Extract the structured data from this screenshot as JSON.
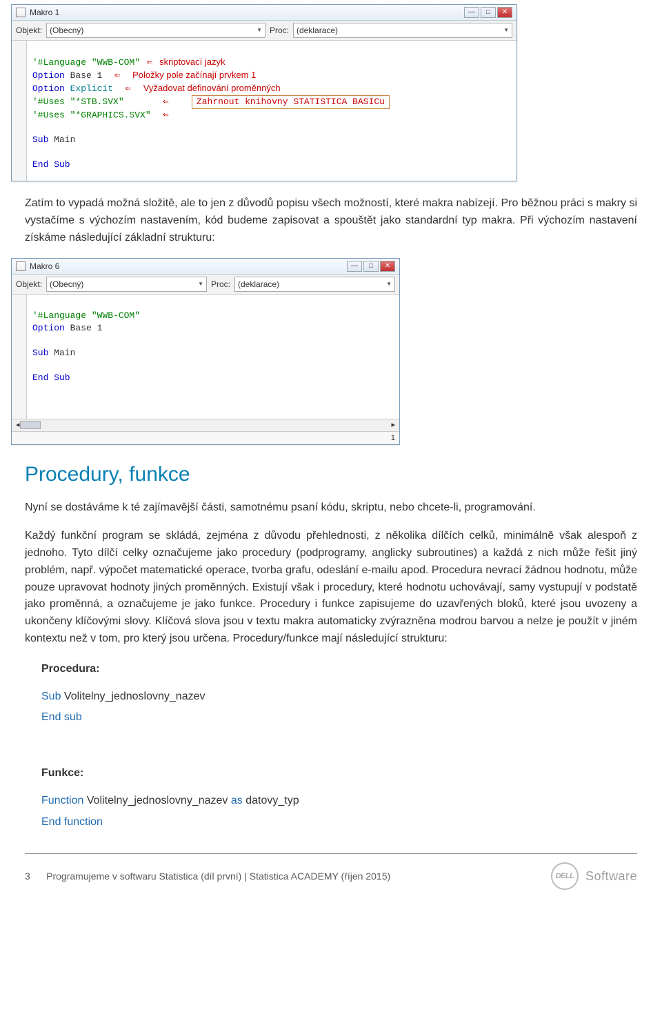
{
  "ide1": {
    "title": "Makro 1",
    "objektLabel": "Objekt:",
    "objektValue": "(Obecný)",
    "procLabel": "Proc:",
    "procValue": "(deklarace)",
    "code": {
      "l1a": "'#Language \"WWB-COM\"",
      "l1ann": "skriptovací jazyk",
      "l2a": "Option",
      "l2b": " Base 1",
      "l2ann": "Položky pole začínají prvkem 1",
      "l3a": "Option",
      "l3b": " Explicit",
      "l3ann": "Vyžadovat definování proměnných",
      "l4": "'#Uses \"*STB.SVX\"",
      "l45ann": "Zahrnout knihovny STATISTICA BASICu",
      "l5": "'#Uses \"*GRAPHICS.SVX\"",
      "lsub": "Sub",
      "lmain": " Main",
      "lend": "End",
      "lsub2": " Sub"
    }
  },
  "para1": "Zatím to vypadá možná složitě, ale to jen z důvodů popisu všech možností, které makra nabízejí. Pro běžnou práci s makry si vystačíme s výchozím nastavením, kód budeme zapisovat a spouštět jako standardní typ makra. Při výchozím nastavení získáme následující základní strukturu:",
  "ide2": {
    "title": "Makro 6",
    "objektLabel": "Objekt:",
    "objektValue": "(Obecný)",
    "procLabel": "Proc:",
    "procValue": "(deklarace)",
    "code": {
      "l1": "'#Language \"WWB-COM\"",
      "l2a": "Option",
      "l2b": " Base 1",
      "lsub": "Sub",
      "lmain": " Main",
      "lend": "End",
      "lsub2": " Sub"
    },
    "status": "1"
  },
  "heading": "Procedury, funkce",
  "para2": "Nyní se dostáváme k té zajímavější části, samotnému psaní kódu, skriptu, nebo chcete-li, programování.",
  "para3": "Každý funkční program se skládá, zejména z důvodu přehlednosti, z několika dílčích celků, minimálně však alespoň z jednoho. Tyto dílčí celky označujeme jako procedury (podprogramy, anglicky subroutines) a každá z nich může řešit jiný problém, např. výpočet matematické operace, tvorba grafu, odeslání e-mailu apod. Procedura nevrací žádnou hodnotu, může pouze upravovat hodnoty jiných proměnných. Existují však i procedury, které hodnotu uchovávají, samy vystupují v podstatě jako proměnná, a označujeme je jako funkce. Procedury i funkce zapisujeme do uzavřených bloků, které jsou uvozeny a ukončeny klíčovými slovy. Klíčová slova jsou v textu makra automaticky zvýrazněna modrou barvou a nelze je použít v jiném kontextu než v tom, pro který jsou určena. Procedury/funkce mají následující strukturu:",
  "proc": {
    "title": "Procedura:",
    "l1a": "Sub",
    "l1b": " Volitelny_jednoslovny_nazev",
    "l2": "End sub"
  },
  "func": {
    "title": "Funkce:",
    "l1a": "Function",
    "l1b": " Volitelny_jednoslovny_nazev ",
    "l1c": "as",
    "l1d": " datovy_typ",
    "l2": "End function"
  },
  "footer": {
    "page": "3",
    "text": "Programujeme v softwaru Statistica (díl první)   |   Statistica ACADEMY (říjen 2015)",
    "brand": "Software",
    "dell": "DELL"
  }
}
